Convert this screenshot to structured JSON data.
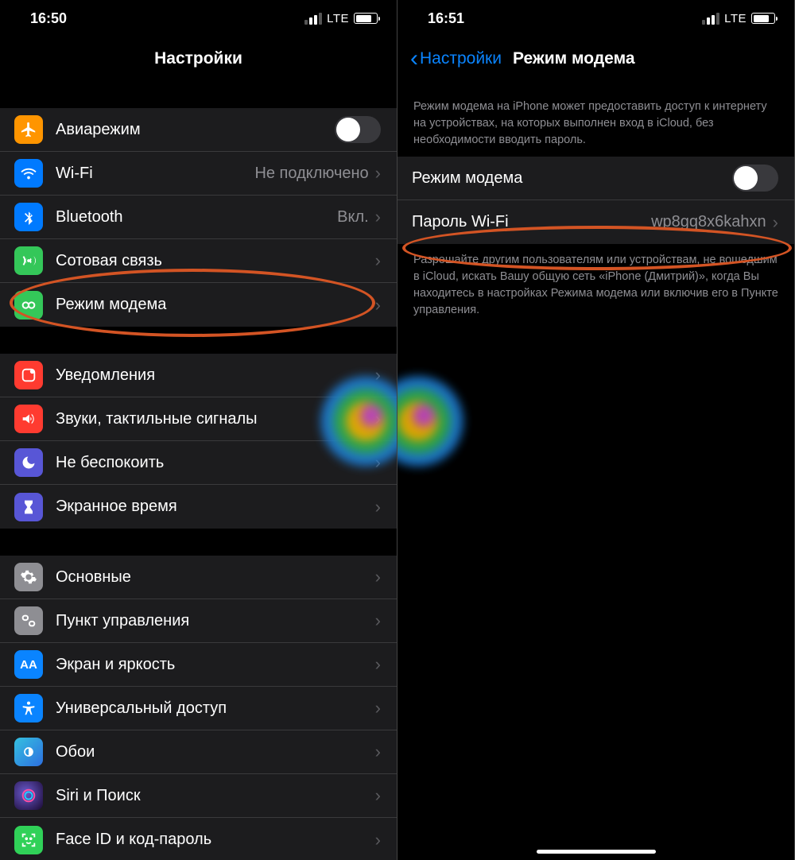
{
  "phone1": {
    "status": {
      "time": "16:50",
      "net": "LTE"
    },
    "title": "Настройки",
    "group1": [
      {
        "key": "airplane",
        "label": "Авиарежим",
        "control": "toggle-off"
      },
      {
        "key": "wifi",
        "label": "Wi-Fi",
        "value": "Не подключено",
        "chevron": true
      },
      {
        "key": "bluetooth",
        "label": "Bluetooth",
        "value": "Вкл.",
        "chevron": true
      },
      {
        "key": "cellular",
        "label": "Сотовая связь",
        "chevron": true
      },
      {
        "key": "hotspot",
        "label": "Режим модема",
        "chevron": true
      }
    ],
    "group2": [
      {
        "key": "notifications",
        "label": "Уведомления",
        "chevron": true
      },
      {
        "key": "sounds",
        "label": "Звуки, тактильные сигналы",
        "chevron": true
      },
      {
        "key": "dnd",
        "label": "Не беспокоить",
        "chevron": true
      },
      {
        "key": "screentime",
        "label": "Экранное время",
        "chevron": true
      }
    ],
    "group3": [
      {
        "key": "general",
        "label": "Основные",
        "chevron": true
      },
      {
        "key": "controlcenter",
        "label": "Пункт управления",
        "chevron": true
      },
      {
        "key": "display",
        "label": "Экран и яркость",
        "chevron": true
      },
      {
        "key": "accessibility",
        "label": "Универсальный доступ",
        "chevron": true
      },
      {
        "key": "wallpaper",
        "label": "Обои",
        "chevron": true
      },
      {
        "key": "siri",
        "label": "Siri и Поиск",
        "chevron": true
      },
      {
        "key": "faceid",
        "label": "Face ID и код-пароль",
        "chevron": true
      }
    ]
  },
  "phone2": {
    "status": {
      "time": "16:51",
      "net": "LTE"
    },
    "back": "Настройки",
    "title": "Режим модема",
    "intro": "Режим модема на iPhone может предоставить доступ к интернету на устройствах, на которых выполнен вход в iCloud, без необходимости вводить пароль.",
    "rows": [
      {
        "key": "hotspot-toggle",
        "label": "Режим модема",
        "control": "toggle-off"
      },
      {
        "key": "wifi-password",
        "label": "Пароль Wi-Fi",
        "value": "wp8gq8x6kahxn",
        "chevron": true
      }
    ],
    "outro": "Разрешайте другим пользователям или устройствам, не вошедшим в iCloud, искать Вашу общую сеть «iPhone (Дмитрий)», когда Вы находитесь в настройках Режима модема или включив его в Пункте управления."
  }
}
